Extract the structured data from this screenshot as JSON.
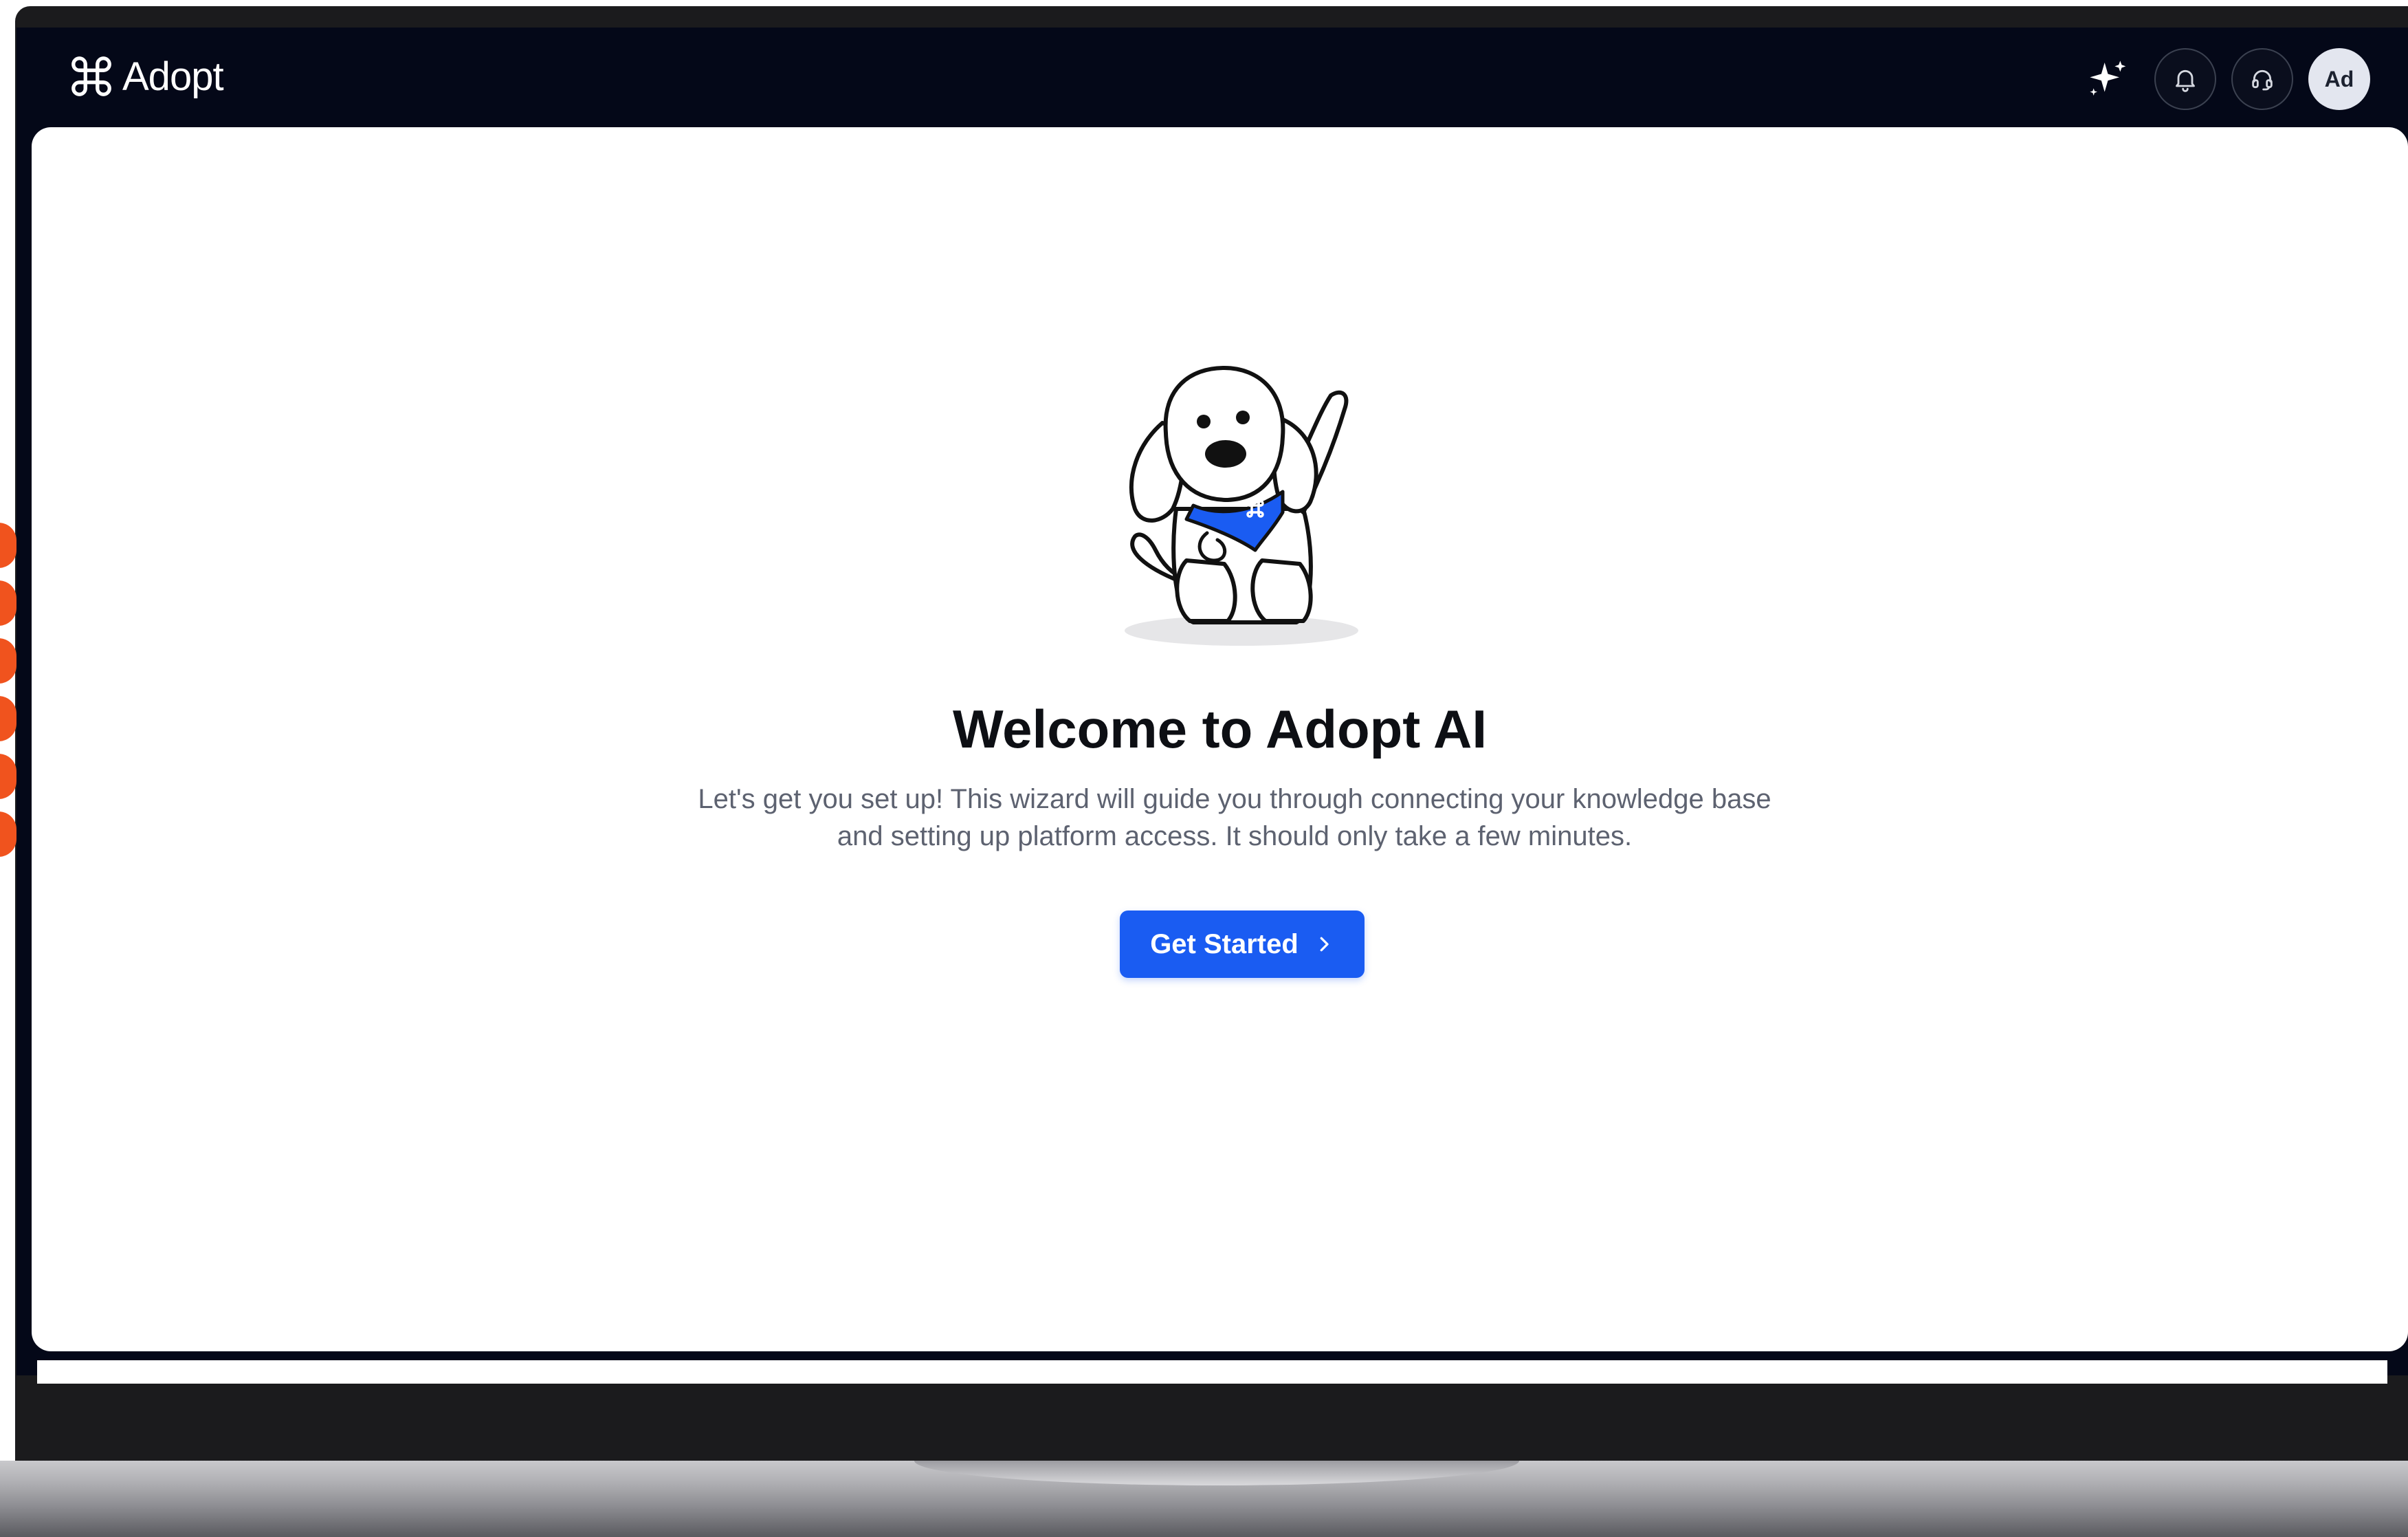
{
  "header": {
    "logo_text": "Adopt",
    "logo_icon": "command-key-icon",
    "actions": [
      {
        "name": "ai-sparkle-button",
        "icon": "sparkle-icon"
      },
      {
        "name": "notifications-button",
        "icon": "bell-icon"
      },
      {
        "name": "support-button",
        "icon": "headset-icon"
      }
    ],
    "avatar_initials": "Ad"
  },
  "main": {
    "illustration": "dog-mascot-waving",
    "title": "Welcome to Adopt AI",
    "description": "Let's get you set up! This wizard will guide you through connecting your knowledge base and setting up platform access. It should only take a few minutes.",
    "cta_label": "Get Started",
    "cta_icon": "chevron-right-icon"
  },
  "colors": {
    "topbar_bg": "#040818",
    "accent": "#1a5cf2",
    "side_tab": "#f0531e"
  }
}
